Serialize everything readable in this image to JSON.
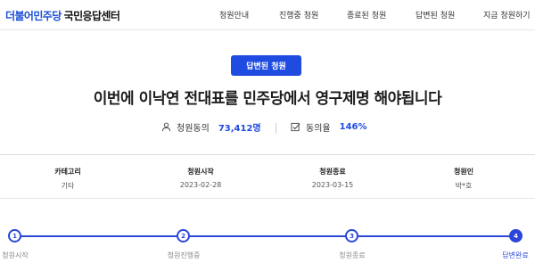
{
  "header": {
    "logo_brand": "더불어민주당",
    "logo_rest": "국민응답센터",
    "nav": [
      "청원안내",
      "진행중 청원",
      "종료된 청원",
      "답변된 청원",
      "지금 청원하기"
    ]
  },
  "petition": {
    "status_badge": "답변된 청원",
    "title": "이번에 이낙연 전대표를 민주당에서 영구제명 해야됩니다",
    "agree_label": "청원동의",
    "agree_count": "73,412명",
    "agree_icon": "person-icon",
    "rate_label": "동의율",
    "rate_value": "146%",
    "rate_icon": "check-square-icon"
  },
  "info": [
    {
      "key": "카테고리",
      "value": "기타"
    },
    {
      "key": "청원시작",
      "value": "2023-02-28"
    },
    {
      "key": "청원종료",
      "value": "2023-03-15"
    },
    {
      "key": "청원인",
      "value": "박*호"
    }
  ],
  "progress": {
    "steps": [
      {
        "num": "1",
        "label": "청원시작"
      },
      {
        "num": "2",
        "label": "청원진행중"
      },
      {
        "num": "3",
        "label": "청원종료"
      },
      {
        "num": "4",
        "label": "답변완료"
      }
    ],
    "current_step": 4
  },
  "colors": {
    "accent": "#1f4be0",
    "brand": "#1a4fd6"
  }
}
